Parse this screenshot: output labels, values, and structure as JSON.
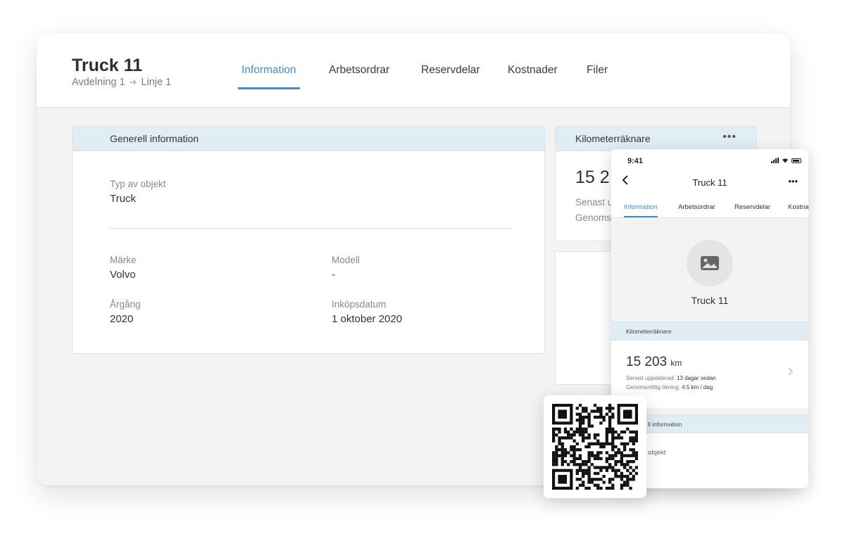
{
  "window": {
    "title": "Truck 11",
    "breadcrumb": [
      "Avdelning 1",
      "Linje 1"
    ],
    "tabs": [
      {
        "label": "Information",
        "active": true
      },
      {
        "label": "Arbetsordrar",
        "active": false
      },
      {
        "label": "Reservdelar",
        "active": false
      },
      {
        "label": "Kostnader",
        "active": false
      },
      {
        "label": "Filer",
        "active": false
      }
    ]
  },
  "general": {
    "header": "Generell information",
    "type_label": "Typ av objekt",
    "type_value": "Truck",
    "brand_label": "Märke",
    "brand_value": "Volvo",
    "model_label": "Modell",
    "model_value": "-",
    "year_label": "Årgång",
    "year_value": "2020",
    "purchase_label": "Inköpsdatum",
    "purchase_value": "1 oktober 2020"
  },
  "odometer": {
    "header": "Kilometerräknare",
    "value_partial": "15 2",
    "updated_partial": "Senast u",
    "average_partial": "Genoms"
  },
  "phone": {
    "time": "9:41",
    "title": "Truck 11",
    "tabs": [
      {
        "label": "Information",
        "active": true
      },
      {
        "label": "Arbetsordrar",
        "active": false
      },
      {
        "label": "Reservdelar",
        "active": false
      },
      {
        "label": "Kostna",
        "active": false
      }
    ],
    "object_name": "Truck 11",
    "km_section": "Kilometerräknare",
    "km_value": "15 203",
    "km_unit": "km",
    "updated_label": "Senast uppdaterad:",
    "updated_value": "13 dagar sedan",
    "average_label": "Genomsnittlig ökning:",
    "average_value": "4.5 km / dag",
    "general_section_partial": "ll information",
    "type_partial": "objekt"
  },
  "colors": {
    "accent": "#3f8fc6",
    "section_header_bg": "#e1edf5",
    "window_bg": "#f3f3f3"
  },
  "icons": {
    "more": "more-dots-icon",
    "back": "chevron-left-icon",
    "image": "image-placeholder-icon",
    "row_chevron": "chevron-right-icon",
    "qr": "qr-code-icon"
  }
}
